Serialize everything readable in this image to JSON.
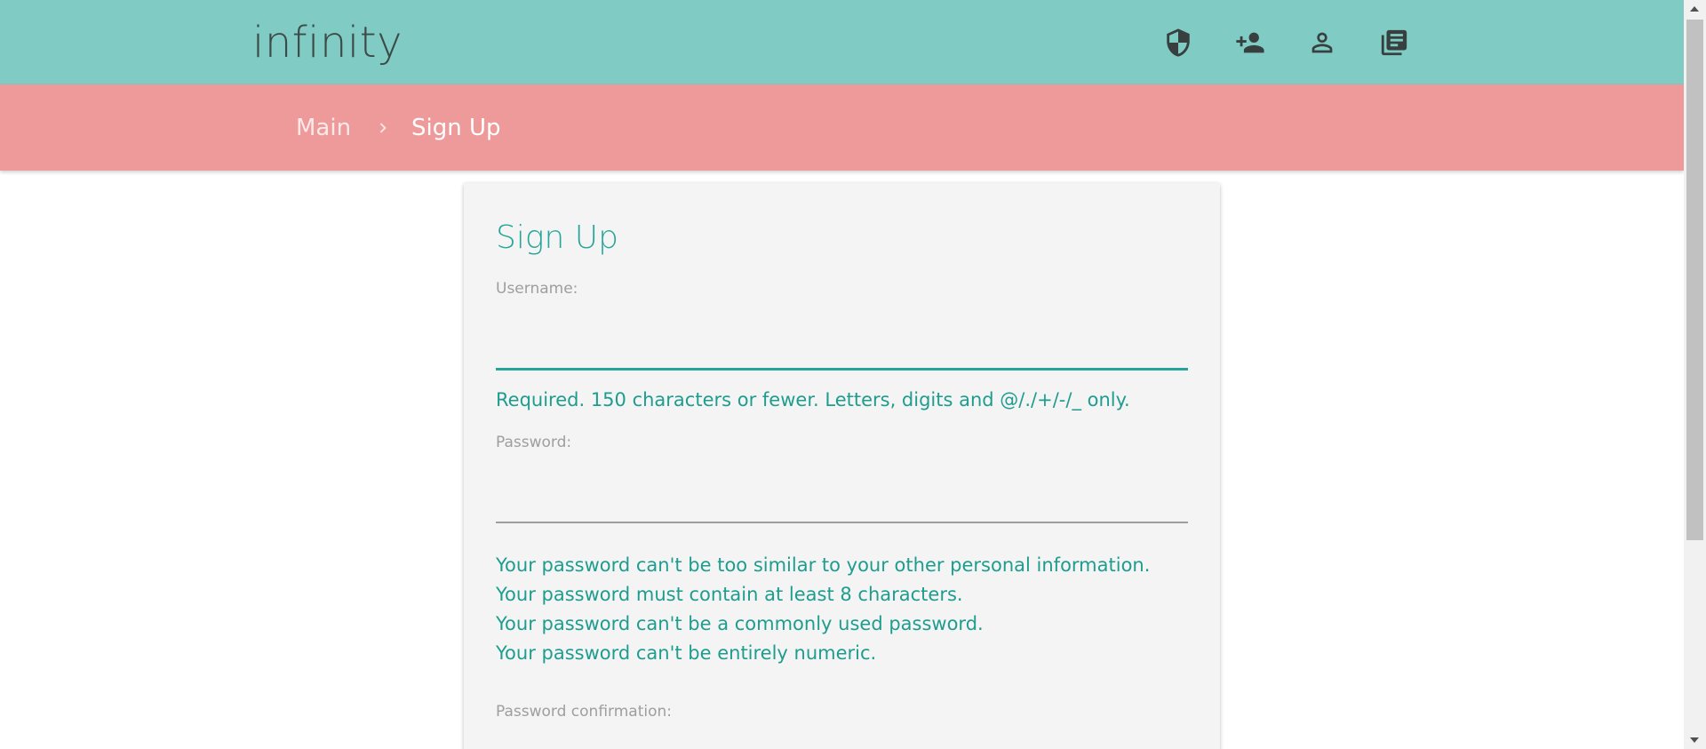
{
  "header": {
    "brand": "infinity",
    "icons": [
      {
        "name": "admin-shield-icon"
      },
      {
        "name": "add-user-icon"
      },
      {
        "name": "user-profile-icon"
      },
      {
        "name": "library-books-icon"
      }
    ]
  },
  "breadcrumb": {
    "items": [
      "Main",
      "Sign Up"
    ],
    "separator_icon": "chevron-right-icon"
  },
  "form": {
    "title": "Sign Up",
    "username": {
      "label": "Username:",
      "value": "",
      "help": "Required. 150 characters or fewer. Letters, digits and @/./+/-/_ only."
    },
    "password": {
      "label": "Password:",
      "value": "",
      "help": [
        "Your password can't be too similar to your other personal information.",
        "Your password must contain at least 8 characters.",
        "Your password can't be a commonly used password.",
        "Your password can't be entirely numeric."
      ]
    },
    "password_confirmation": {
      "label": "Password confirmation:",
      "value": ""
    }
  },
  "colors": {
    "header_bg": "#80cbc4",
    "breadcrumb_bg": "#ef9a9a",
    "accent": "#26a69a",
    "card_bg": "#f4f4f4"
  }
}
